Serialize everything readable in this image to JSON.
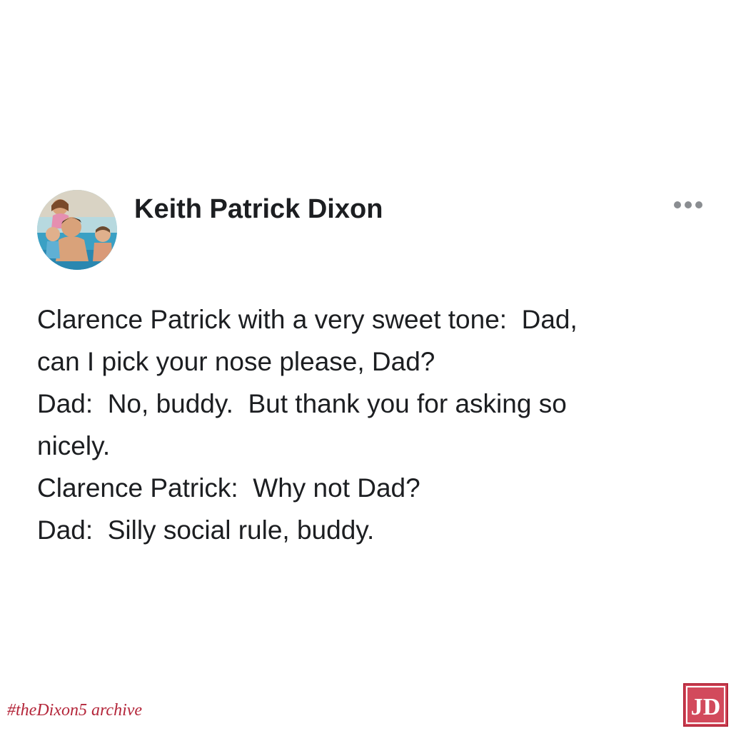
{
  "post": {
    "author": "Keith Patrick Dixon",
    "more_icon": "more-horizontal-icon",
    "lines": [
      "Clarence Patrick with a very sweet tone:  Dad,",
      "can I pick your nose please, Dad?",
      "Dad:  No, buddy.  But thank you for asking so",
      "nicely.",
      "Clarence Patrick:  Why not Dad?",
      "Dad:  Silly social rule, buddy."
    ]
  },
  "watermark": {
    "text": "#theDixon5 archive",
    "logo_text": "JD",
    "color": "#b4263a"
  }
}
